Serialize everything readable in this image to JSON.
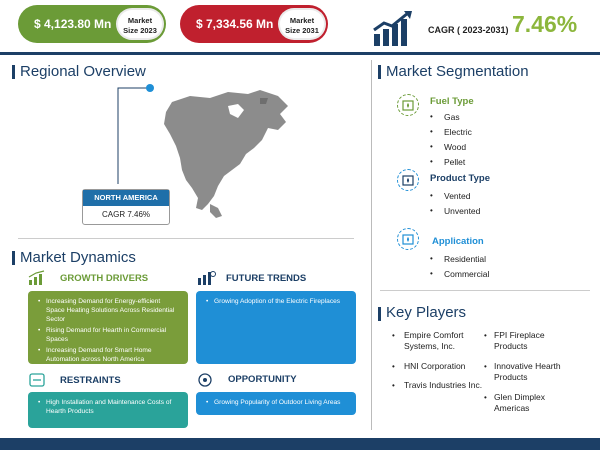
{
  "header": {
    "market_size_2023": {
      "value": "$ 4,123.80 Mn",
      "label_line1": "Market",
      "label_line2": "Size 2023"
    },
    "market_size_2031": {
      "value": "$ 7,334.56 Mn",
      "label_line1": "Market",
      "label_line2": "Size 2031"
    },
    "cagr_label": "CAGR ( 2023-2031)",
    "cagr_value": "7.46%",
    "colors": {
      "green": "#6b9b37",
      "red": "#c0202e",
      "navy": "#1c3f66",
      "blue": "#1f8fd6"
    }
  },
  "regional": {
    "title": "Regional Overview",
    "region_name": "NORTH AMERICA",
    "region_cagr": "CAGR 7.46%"
  },
  "segmentation": {
    "title": "Market Segmentation",
    "groups": [
      {
        "title": "Fuel Type",
        "icon": "fireplace-icon",
        "items": [
          "Gas",
          "Electric",
          "Wood",
          "Pellet"
        ]
      },
      {
        "title": "Product Type",
        "icon": "fireplace-icon",
        "items": [
          "Vented",
          "Unvented"
        ]
      },
      {
        "title": "Application",
        "icon": "fireplace-icon",
        "items": [
          "Residential",
          "Commercial"
        ]
      }
    ]
  },
  "dynamics": {
    "title": "Market Dynamics",
    "growth_drivers": {
      "title": "GROWTH DRIVERS",
      "items": [
        "Increasing Demand for Energy-efficient Space Heating Solutions Across Residential Sector",
        "Rising Demand for Hearth in Commercial Spaces",
        "Increasing Demand for Smart Home Automation across North America"
      ]
    },
    "future_trends": {
      "title": "FUTURE TRENDS",
      "items": [
        "Growing Adoption of the Electric Fireplaces"
      ]
    },
    "restraints": {
      "title": "RESTRAINTS",
      "items": [
        "High Installation and Maintenance Costs of Hearth Products"
      ]
    },
    "opportunity": {
      "title": "OPPORTUNITY",
      "items": [
        "Growing Popularity of Outdoor Living Areas"
      ]
    }
  },
  "key_players": {
    "title": "Key Players",
    "left": [
      "Empire Comfort Systems, Inc.",
      "HNI Corporation",
      "Travis Industries Inc."
    ],
    "right": [
      "FPI Fireplace Products",
      "Innovative Hearth Products",
      "Glen Dimplex Americas"
    ]
  }
}
